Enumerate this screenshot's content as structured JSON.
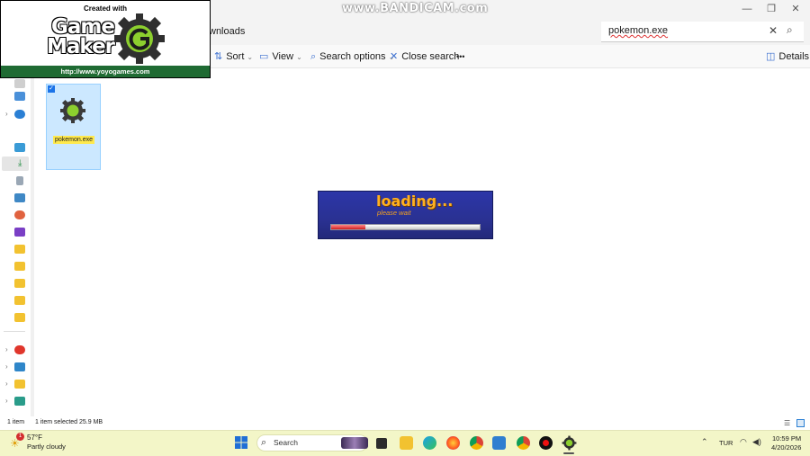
{
  "window": {
    "watermark": "www.BANDICAM.com",
    "controls": [
      "minimize",
      "restore",
      "close"
    ]
  },
  "address": {
    "path_visible": "wnloads"
  },
  "search": {
    "value": "pokemon.exe"
  },
  "commandbar": {
    "sort_label": "Sort",
    "view_label": "View",
    "search_options_label": "Search options",
    "close_search_label": "Close search",
    "more_label": "•••",
    "details_label": "Details"
  },
  "files": [
    {
      "name": "pokemon.exe",
      "selected": true,
      "icon": "gamemaker-gear-icon"
    }
  ],
  "splash": {
    "created_with": "Created with",
    "brand_line1": "Game",
    "brand_line2": "Maker",
    "url": "http://www.yoyogames.com",
    "colors": {
      "banner": "#1f6b33",
      "gear": "#8ccf2e"
    }
  },
  "loading": {
    "title": "loading...",
    "subtitle": "please wait",
    "progress": 0.23,
    "colors": {
      "background": "#2a3192",
      "title": "#ffb020",
      "fill": "#d11e1e"
    }
  },
  "statusbar": {
    "item_count": "1 item",
    "selection": "1 item selected  25.9 MB"
  },
  "taskbar": {
    "weather_temp": "57°F",
    "weather_desc": "Partly cloudy",
    "weather_badge": "1",
    "search_label": "Search",
    "language": "TUR",
    "time": "10:59 PM",
    "date": "4/20/2026",
    "apps": [
      "file-manager-icon",
      "file-explorer-icon",
      "edge-icon",
      "firefox-icon",
      "chrome-icon",
      "store-icon",
      "chrome-profile-icon",
      "bandicam-record-icon",
      "gamemaker-icon"
    ]
  }
}
